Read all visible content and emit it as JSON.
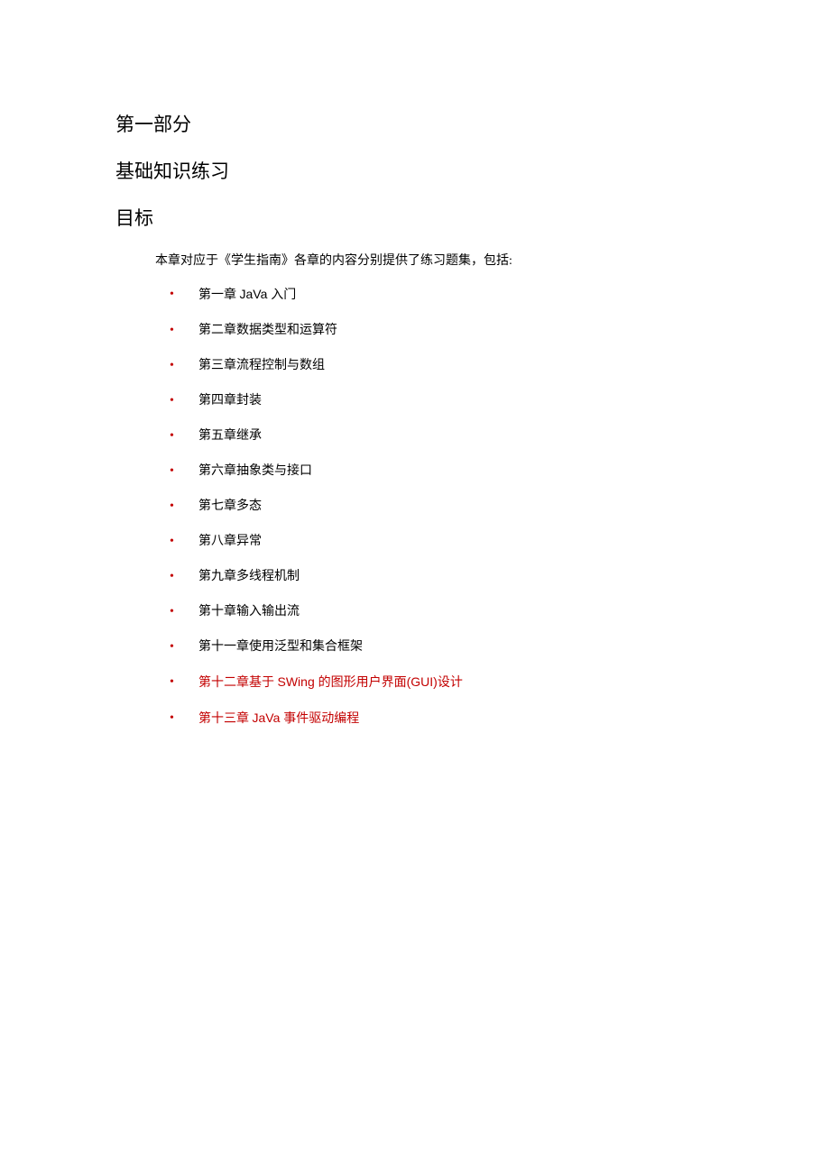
{
  "headings": {
    "part": "第一部分",
    "subtitle": "基础知识练习",
    "goal": "目标"
  },
  "intro": "本章对应于《学生指南》各章的内容分别提供了练习题集，包括:",
  "chapters": [
    {
      "segments": [
        {
          "t": "第一章 ",
          "cls": "black"
        },
        {
          "t": "JaVa ",
          "cls": "black latin"
        },
        {
          "t": "入门",
          "cls": "black"
        }
      ]
    },
    {
      "segments": [
        {
          "t": "第二章数据类型和运算符",
          "cls": "black"
        }
      ]
    },
    {
      "segments": [
        {
          "t": "第三章流程控制与数组",
          "cls": "black"
        }
      ]
    },
    {
      "segments": [
        {
          "t": "第四章封装",
          "cls": "black"
        }
      ]
    },
    {
      "segments": [
        {
          "t": "第五章继承",
          "cls": "black"
        }
      ]
    },
    {
      "segments": [
        {
          "t": "第六章抽象类与接口",
          "cls": "black"
        }
      ]
    },
    {
      "segments": [
        {
          "t": "第七章多态",
          "cls": "black"
        }
      ]
    },
    {
      "segments": [
        {
          "t": "第八章异常",
          "cls": "black"
        }
      ]
    },
    {
      "segments": [
        {
          "t": "第九章多线程机制",
          "cls": "black"
        }
      ]
    },
    {
      "segments": [
        {
          "t": "第十章输入输出流",
          "cls": "black"
        }
      ]
    },
    {
      "segments": [
        {
          "t": "第十一章使用泛型和集合框架",
          "cls": "black"
        }
      ]
    },
    {
      "segments": [
        {
          "t": "第十二章基于 ",
          "cls": "red"
        },
        {
          "t": "SWing ",
          "cls": "red latin"
        },
        {
          "t": "的图形用户界面",
          "cls": "red"
        },
        {
          "t": "(GUI)",
          "cls": "red latin"
        },
        {
          "t": "设计",
          "cls": "red"
        }
      ]
    },
    {
      "segments": [
        {
          "t": "第十三章 ",
          "cls": "red"
        },
        {
          "t": "JaVa ",
          "cls": "red latin"
        },
        {
          "t": "事件驱动编程",
          "cls": "red"
        }
      ]
    }
  ]
}
